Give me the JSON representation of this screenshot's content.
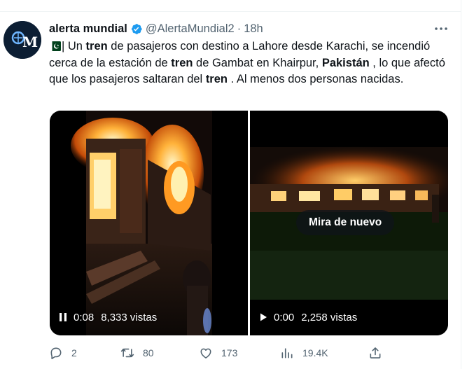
{
  "author": {
    "name": "alerta mundial",
    "handle": "@AlertaMundial2",
    "separator": "·",
    "time": "18h",
    "avatar_text": "M"
  },
  "tweet": {
    "segments": [
      "| Un ",
      "tren",
      " de pasajeros con destino a Lahore desde Karachi, se incendió cerca de la estación de ",
      "tren",
      " de Gambat en Khairpur, ",
      "Pakistán",
      " , lo que afectó que los pasajeros saltaran del ",
      "tren",
      " . Al menos dos personas nacidas."
    ]
  },
  "media": {
    "video1": {
      "time": "0:08",
      "views": "8,333 vistas",
      "state": "playing"
    },
    "video2": {
      "time": "0:00",
      "views": "2,258 vistas",
      "replay_label": "Mira de nuevo",
      "state": "paused"
    }
  },
  "actions": {
    "replies": "2",
    "retweets": "80",
    "likes": "173",
    "views": "19.4K"
  },
  "colors": {
    "text": "#0f1419",
    "secondary": "#536471",
    "verified": "#1d9bf0",
    "border": "#eff3f4"
  },
  "icons": [
    "verified-badge-icon",
    "more-icon",
    "pakistan-flag-icon",
    "pause-icon",
    "play-icon",
    "reply-icon",
    "retweet-icon",
    "like-icon",
    "views-icon",
    "share-icon"
  ]
}
